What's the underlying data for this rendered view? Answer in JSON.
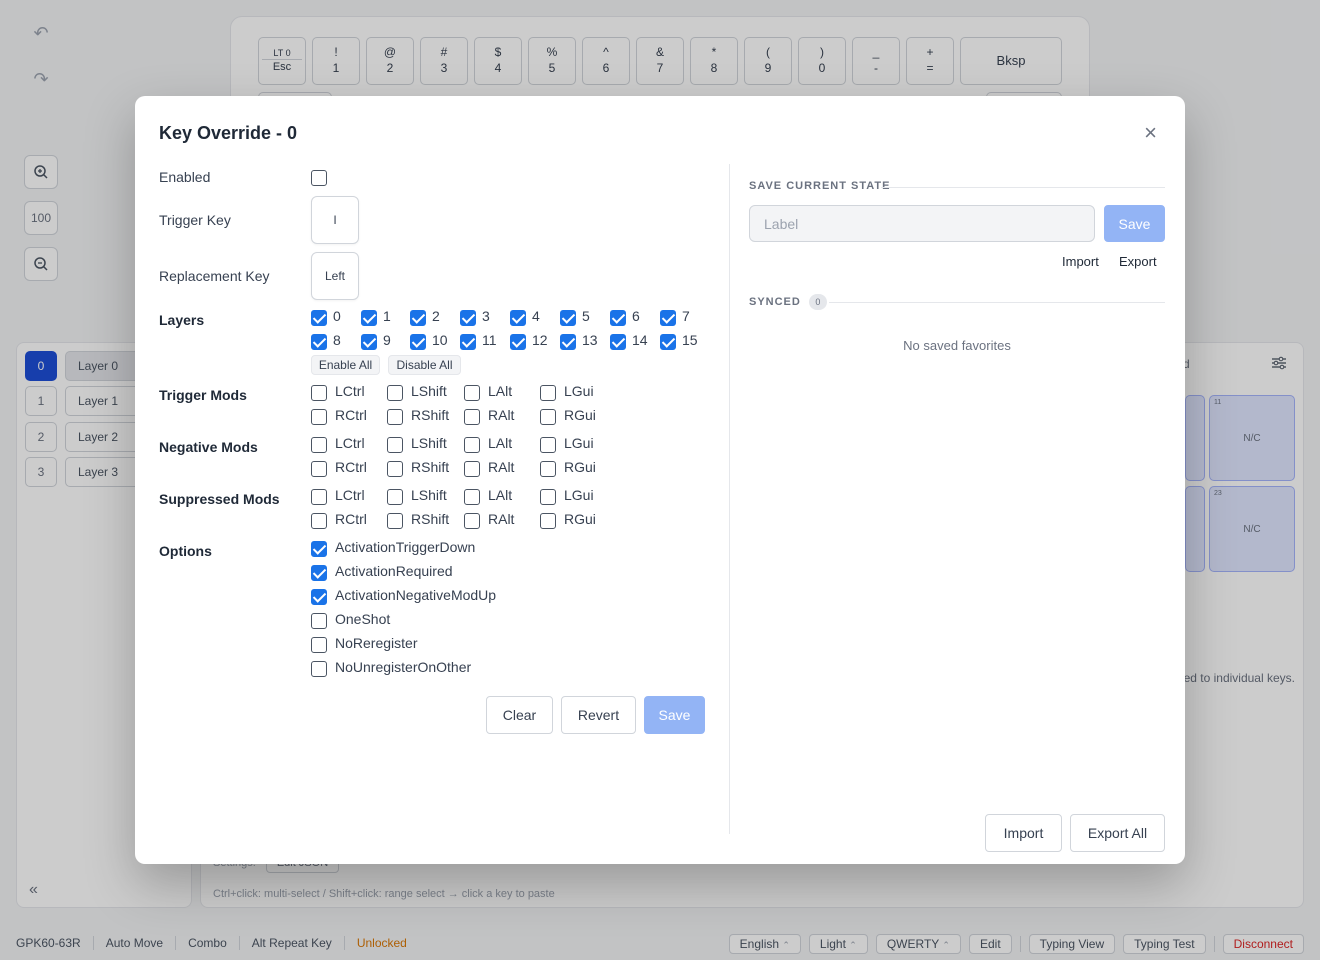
{
  "background": {
    "zoom_level": "100",
    "keyboard_row1": [
      {
        "top": "LT 0",
        "bottom": "Esc"
      },
      {
        "top": "!",
        "bottom": "1"
      },
      {
        "top": "@",
        "bottom": "2"
      },
      {
        "top": "#",
        "bottom": "3"
      },
      {
        "top": "$",
        "bottom": "4"
      },
      {
        "top": "%",
        "bottom": "5"
      },
      {
        "top": "^",
        "bottom": "6"
      },
      {
        "top": "&",
        "bottom": "7"
      },
      {
        "top": "*",
        "bottom": "8"
      },
      {
        "top": "(",
        "bottom": "9"
      },
      {
        "top": ")",
        "bottom": "0"
      },
      {
        "top": "_",
        "bottom": "-"
      },
      {
        "top": "+",
        "bottom": "="
      },
      {
        "top": "",
        "bottom": "Bksp"
      }
    ],
    "layers": [
      {
        "num": "0",
        "name": "Layer 0"
      },
      {
        "num": "1",
        "name": "Layer 1"
      },
      {
        "num": "2",
        "name": "Layer 2"
      },
      {
        "num": "3",
        "name": "Layer 3"
      }
    ],
    "collapse": "«",
    "tab_fragment": "rd",
    "nc_keys": [
      {
        "num": "11",
        "label": "N/C"
      },
      {
        "num": "23",
        "label": "N/C"
      }
    ],
    "hint_fragment": "ed to individual keys.",
    "settings_label": "Settings:",
    "edit_json": "Edit JSON",
    "paste_hint": "Ctrl+click: multi-select / Shift+click: range select → click a key to paste"
  },
  "status_bar": {
    "left": [
      "GPK60-63R",
      "Auto Move",
      "Combo",
      "Alt Repeat Key"
    ],
    "unlocked": "Unlocked",
    "language": "English",
    "theme": "Light",
    "layout": "QWERTY",
    "edit": "Edit",
    "typing_view": "Typing View",
    "typing_test": "Typing Test",
    "disconnect": "Disconnect"
  },
  "modal": {
    "title": "Key Override - 0",
    "close": "×",
    "enabled_label": "Enabled",
    "enabled": false,
    "trigger_key_label": "Trigger Key",
    "trigger_key": "I",
    "replacement_key_label": "Replacement Key",
    "replacement_key": "Left",
    "layers_label": "Layers",
    "layers": [
      "0",
      "1",
      "2",
      "3",
      "4",
      "5",
      "6",
      "7",
      "8",
      "9",
      "10",
      "11",
      "12",
      "13",
      "14",
      "15"
    ],
    "enable_all": "Enable All",
    "disable_all": "Disable All",
    "mods": [
      "LCtrl",
      "LShift",
      "LAlt",
      "LGui",
      "RCtrl",
      "RShift",
      "RAlt",
      "RGui"
    ],
    "trigger_mods_label": "Trigger Mods",
    "negative_mods_label": "Negative Mods",
    "suppressed_mods_label": "Suppressed Mods",
    "options_label": "Options",
    "options": [
      {
        "label": "ActivationTriggerDown",
        "checked": true
      },
      {
        "label": "ActivationRequired",
        "checked": true
      },
      {
        "label": "ActivationNegativeModUp",
        "checked": true
      },
      {
        "label": "OneShot",
        "checked": false
      },
      {
        "label": "NoReregister",
        "checked": false
      },
      {
        "label": "NoUnregisterOnOther",
        "checked": false
      }
    ],
    "clear": "Clear",
    "revert": "Revert",
    "save": "Save",
    "save_state_heading": "SAVE CURRENT STATE",
    "label_placeholder": "Label",
    "save_state_button": "Save",
    "import_link": "Import",
    "export_link": "Export",
    "synced_heading": "SYNCED",
    "synced_count": "0",
    "no_favorites": "No saved favorites",
    "import_button": "Import",
    "export_all_button": "Export All"
  }
}
